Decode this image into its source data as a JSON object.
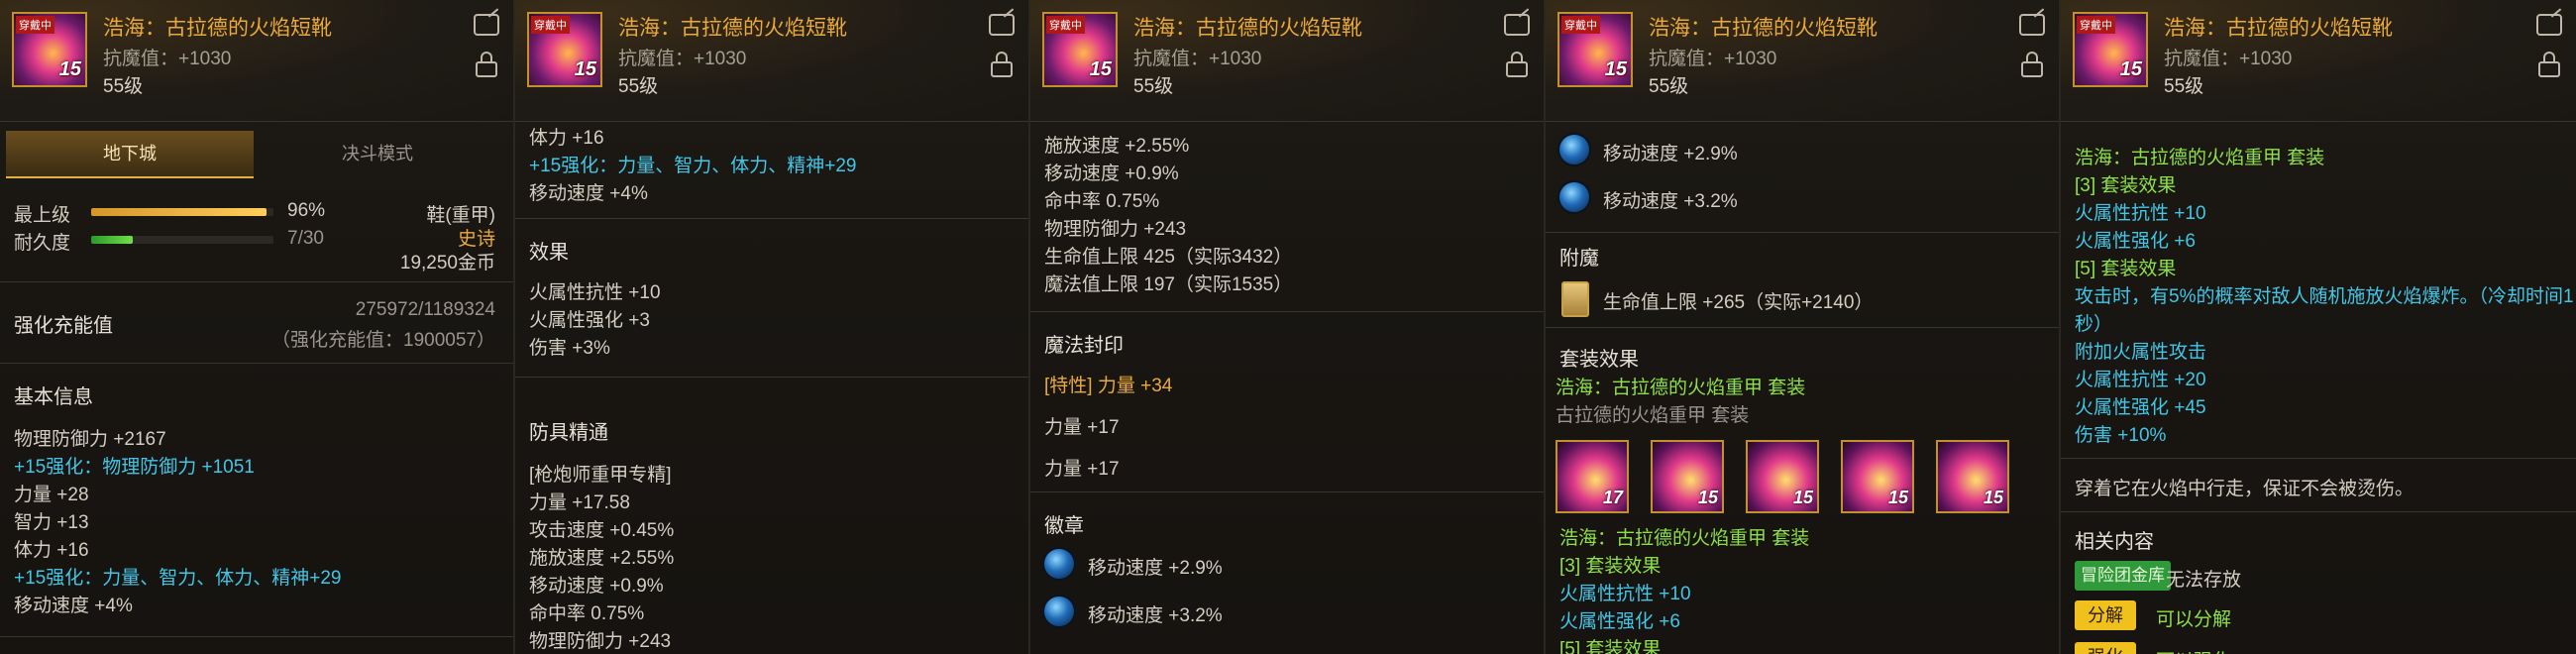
{
  "item": {
    "name": "浩海：古拉德的火焰短靴",
    "anti_magic": "抗魔值：+1030",
    "level": "55级",
    "icon_tag": "穿戴中",
    "icon_enhance": "15"
  },
  "p1": {
    "tab_active": "地下城",
    "tab_inactive": "决斗模式",
    "top_level_label": "最上级",
    "top_level_value": "96%",
    "top_level_pct": 96,
    "durability_label": "耐久度",
    "durability_value": "7/30",
    "durability_pct": 23,
    "type": "鞋(重甲)",
    "rarity": "史诗",
    "price": "19,250金币",
    "enhance_label": "强化充能值",
    "enhance_value": "275972/1189324",
    "enhance_sub": "（强化充能值：1900057）",
    "basic_title": "基本信息",
    "lines": [
      "物理防御力 +2167",
      "+15强化：物理防御力 +1051",
      "力量 +28",
      "智力 +13",
      "体力 +16",
      "+15强化：力量、智力、体力、精神+29",
      "移动速度 +4%"
    ]
  },
  "p2": {
    "top": [
      "体力 +16",
      "+15强化：力量、智力、体力、精神+29",
      "移动速度 +4%"
    ],
    "effect_title": "效果",
    "effects": [
      "火属性抗性 +10",
      "火属性强化 +3",
      "伤害 +3%"
    ],
    "mastery_title": "防具精通",
    "mastery": [
      "[枪炮师重甲专精]",
      "力量 +17.58",
      "攻击速度 +0.45%",
      "施放速度 +2.55%",
      "移动速度 +0.9%",
      "命中率 0.75%",
      "物理防御力 +243"
    ]
  },
  "p3": {
    "top": [
      "施放速度 +2.55%",
      "移动速度 +0.9%",
      "命中率 0.75%",
      "物理防御力 +243",
      "生命值上限 425（实际3432）",
      "魔法值上限 197（实际1535）"
    ],
    "seal_title": "魔法封印",
    "seal": [
      "[特性] 力量 +34",
      "力量 +17",
      "力量 +17"
    ],
    "emblem_title": "徽章",
    "emblems": [
      "移动速度 +2.9%",
      "移动速度 +3.2%"
    ]
  },
  "p4": {
    "orbs": [
      "移动速度 +2.9%",
      "移动速度 +3.2%"
    ],
    "enchant_title": "附魔",
    "enchant": "生命值上限 +265（实际+2140）",
    "set_title": "套装效果",
    "set_name": "浩海：古拉德的火焰重甲 套装",
    "set_name_gray": "古拉德的火焰重甲 套装",
    "set_icon_levels": [
      "17",
      "15",
      "15",
      "15",
      "15"
    ],
    "set_lines": [
      "浩海：古拉德的火焰重甲 套装",
      "[3] 套装效果",
      "火属性抗性 +10",
      "火属性强化 +6",
      "[5] 套装效果"
    ]
  },
  "p5": {
    "set_name": "浩海：古拉德的火焰重甲 套装",
    "lines": [
      "[3] 套装效果",
      "火属性抗性 +10",
      "火属性强化 +6",
      "[5] 套装效果"
    ],
    "desc1": "攻击时，有5%的概率对敌人随机施放火焰爆炸。（冷却时间1",
    "desc2": "秒）",
    "lines2": [
      "附加火属性攻击",
      "火属性抗性 +20",
      "火属性强化 +45",
      "伤害 +10%"
    ],
    "flavor": "穿着它在火焰中行走，保证不会被烫伤。",
    "related_title": "相关内容",
    "storage_btn": "冒险团金库",
    "storage_text": "无法存放",
    "decompose_btn": "分解",
    "decompose_text": "可以分解",
    "btn3": "强化",
    "btn3_text": "可以强化"
  }
}
